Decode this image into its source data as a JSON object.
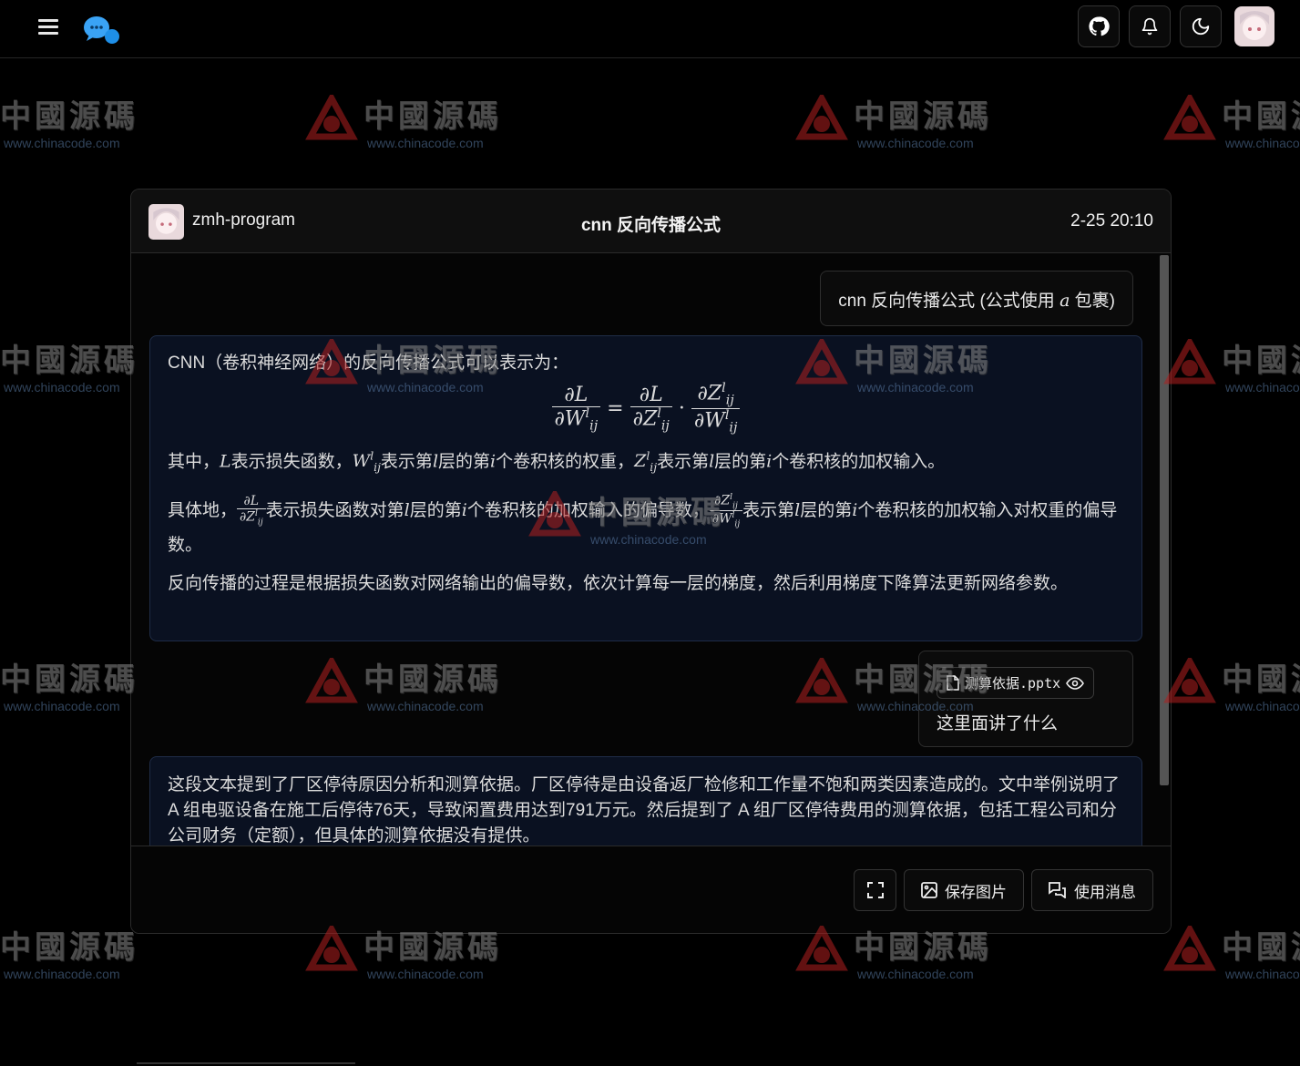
{
  "topbar": {
    "menu_icon": "hamburger-menu-icon",
    "logo_icon": "chat-bubbles-logo-icon",
    "buttons": [
      "github-icon",
      "bell-icon",
      "moon-icon",
      "user-avatar"
    ]
  },
  "card": {
    "user": "zmh-program",
    "title": "cnn 反向传播公式",
    "time": "2-25 20:10"
  },
  "messages": {
    "user1": {
      "text_before": "cnn 反向传播公式 (公式使用 ",
      "math": "a",
      "text_after": " 包裹)"
    },
    "bot1": {
      "intro": "CNN（卷积神经网络）的反向传播公式可以表示为：",
      "p1_a": "其中，",
      "p1_b": "表示损失函数，",
      "p1_c": "表示第",
      "p1_d": "层的第",
      "p1_e": "个卷积核的权重，",
      "p1_f": "表示第",
      "p1_g": "层的第",
      "p1_h": "个卷积核的加权输入。",
      "p2_a": "具体地，",
      "p2_b": "表示损失函数对第",
      "p2_c": "层的第",
      "p2_d": "个卷积核的加权输入的偏导数，",
      "p2_e": "表示第",
      "p2_f": "层的第",
      "p2_g": "个卷积核的加权输入对权重的偏导数。",
      "p3": "反向传播的过程是根据损失函数对网络输出的偏导数，依次计算每一层的梯度，然后利用梯度下降算法更新网络参数。"
    },
    "user2": {
      "file_name": "测算依据.pptx",
      "text": "这里面讲了什么"
    },
    "bot2": {
      "text": "这段文本提到了厂区停待原因分析和测算依据。厂区停待是由设备返厂检修和工作量不饱和两类因素造成的。文中举例说明了 A 组电驱设备在施工后停待76天，导致闲置费用达到791万元。然后提到了 A 组厂区停待费用的测算依据，包括工程公司和分公司财务（定额），但具体的测算依据没有提供。"
    }
  },
  "footer": {
    "fullscreen_icon": "fullscreen-icon",
    "save_image": "保存图片",
    "use_message": "使用消息"
  },
  "watermark": {
    "text": "中國源碼",
    "sub": "www.chinacode.com"
  }
}
